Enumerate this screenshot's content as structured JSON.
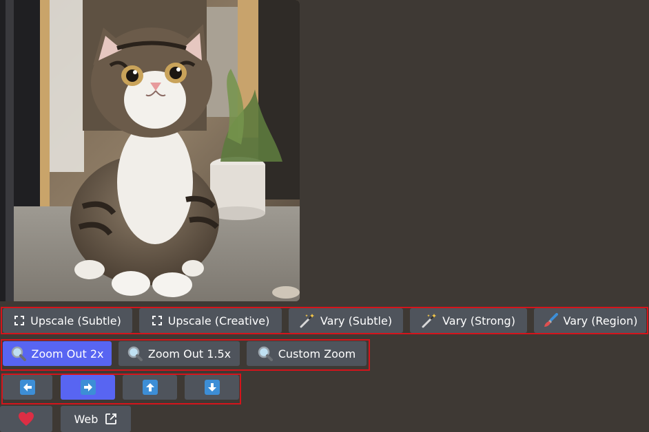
{
  "image": {
    "alt_icon": "kitten-photo"
  },
  "row1": {
    "upscale_subtle": "Upscale (Subtle)",
    "upscale_creative": "Upscale (Creative)",
    "vary_subtle": "Vary (Subtle)",
    "vary_strong": "Vary (Strong)",
    "vary_region": "Vary (Region)"
  },
  "row2": {
    "zoom_out_2x": "Zoom Out 2x",
    "zoom_out_15x": "Zoom Out 1.5x",
    "custom_zoom": "Custom Zoom"
  },
  "row3": {
    "icons": [
      "arrow-left-icon",
      "arrow-right-icon",
      "arrow-up-icon",
      "arrow-down-icon"
    ]
  },
  "row4": {
    "web": "Web"
  },
  "colors": {
    "background": "#3e3934",
    "button": "#4f545c",
    "primary": "#5865f2",
    "outline": "#d5141b",
    "arrow": "#3d8ed6",
    "heart": "#dd2e44"
  }
}
